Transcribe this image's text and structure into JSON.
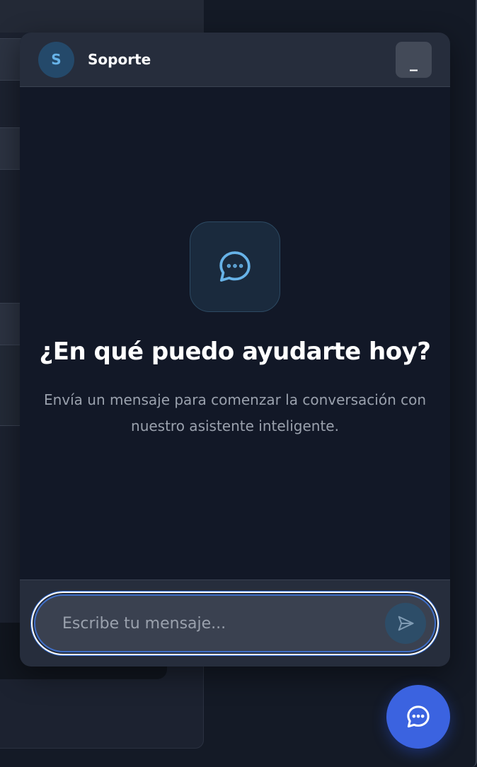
{
  "chat": {
    "avatar_initial": "S",
    "title": "Soporte",
    "minimize_label": "_",
    "empty_state": {
      "icon": "chat-bubble-dots-icon",
      "title": "¿En qué puedo ayudarte hoy?",
      "subtitle": "Envía un mensaje para comenzar la conversación con nuestro asistente inteligente."
    },
    "input": {
      "placeholder": "Escribe tu mensaje...",
      "value": ""
    },
    "send_icon": "send-icon"
  },
  "launcher": {
    "icon": "chat-bubble-dots-icon"
  },
  "colors": {
    "accent": "#3b63e0",
    "avatar_bg": "#24496a",
    "icon_blue": "#67b3e8"
  }
}
